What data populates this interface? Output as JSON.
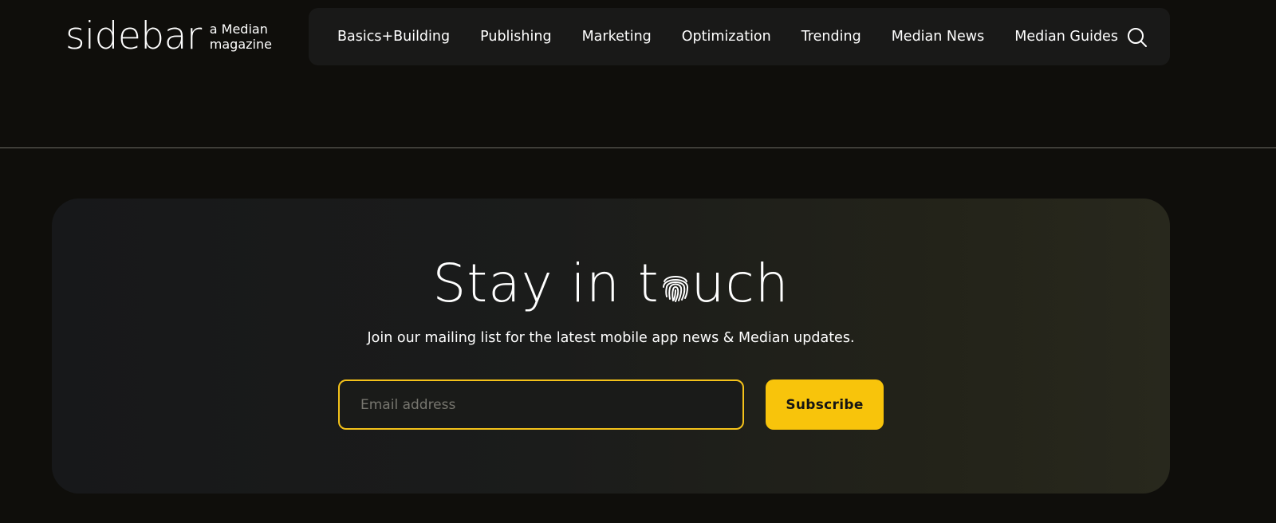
{
  "header": {
    "logo": {
      "word": "sidebar",
      "subtitle_line1": "a Median",
      "subtitle_line2": "magazine"
    },
    "nav": {
      "items": [
        {
          "label": "Basics+Building"
        },
        {
          "label": "Publishing"
        },
        {
          "label": "Marketing"
        },
        {
          "label": "Optimization"
        },
        {
          "label": "Trending"
        },
        {
          "label": "Median News"
        },
        {
          "label": "Median Guides"
        }
      ],
      "search_icon": "search-icon"
    }
  },
  "newsletter": {
    "title_before": "Stay in t",
    "title_icon": "fingerprint-icon",
    "title_after": "uch",
    "subtitle": "Join our mailing list for the latest mobile app news & Median updates.",
    "email_placeholder": "Email address",
    "email_value": "",
    "subscribe_label": "Subscribe"
  },
  "colors": {
    "page_background": "#0f0e0b",
    "nav_background": "#191918",
    "accent": "#f8c40b"
  }
}
